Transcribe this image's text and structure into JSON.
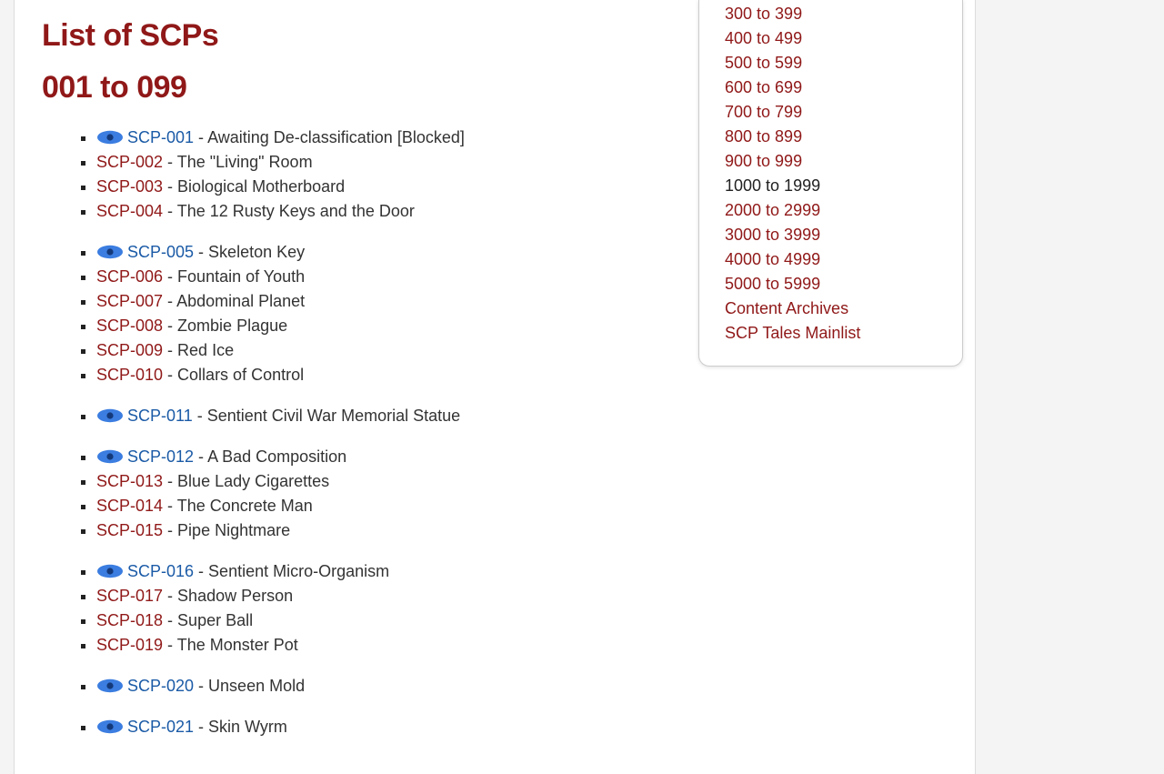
{
  "page": {
    "title": "List of SCPs",
    "section_title": "001 to 099"
  },
  "scp_groups": [
    [
      {
        "id": "SCP-001",
        "title": "Awaiting De-classification [Blocked]",
        "eye": true
      },
      {
        "id": "SCP-002",
        "title": "The \"Living\" Room",
        "eye": false
      },
      {
        "id": "SCP-003",
        "title": "Biological Motherboard",
        "eye": false
      },
      {
        "id": "SCP-004",
        "title": "The 12 Rusty Keys and the Door",
        "eye": false
      }
    ],
    [
      {
        "id": "SCP-005",
        "title": "Skeleton Key",
        "eye": true
      },
      {
        "id": "SCP-006",
        "title": "Fountain of Youth",
        "eye": false
      },
      {
        "id": "SCP-007",
        "title": "Abdominal Planet",
        "eye": false
      },
      {
        "id": "SCP-008",
        "title": "Zombie Plague",
        "eye": false
      },
      {
        "id": "SCP-009",
        "title": "Red Ice",
        "eye": false
      },
      {
        "id": "SCP-010",
        "title": "Collars of Control",
        "eye": false
      }
    ],
    [
      {
        "id": "SCP-011",
        "title": "Sentient Civil War Memorial Statue",
        "eye": true
      }
    ],
    [
      {
        "id": "SCP-012",
        "title": "A Bad Composition",
        "eye": true
      },
      {
        "id": "SCP-013",
        "title": "Blue Lady Cigarettes",
        "eye": false
      },
      {
        "id": "SCP-014",
        "title": "The Concrete Man",
        "eye": false
      },
      {
        "id": "SCP-015",
        "title": "Pipe Nightmare",
        "eye": false
      }
    ],
    [
      {
        "id": "SCP-016",
        "title": "Sentient Micro-Organism",
        "eye": true
      },
      {
        "id": "SCP-017",
        "title": "Shadow Person",
        "eye": false
      },
      {
        "id": "SCP-018",
        "title": "Super Ball",
        "eye": false
      },
      {
        "id": "SCP-019",
        "title": "The Monster Pot",
        "eye": false
      }
    ],
    [
      {
        "id": "SCP-020",
        "title": "Unseen Mold",
        "eye": true
      }
    ],
    [
      {
        "id": "SCP-021",
        "title": "Skin Wyrm",
        "eye": true
      }
    ]
  ],
  "sidebar": {
    "items": [
      {
        "label": "300 to 399",
        "link_style": "red"
      },
      {
        "label": "400 to 499",
        "link_style": "red"
      },
      {
        "label": "500 to 599",
        "link_style": "red"
      },
      {
        "label": "600 to 699",
        "link_style": "red"
      },
      {
        "label": "700 to 799",
        "link_style": "red"
      },
      {
        "label": "800 to 899",
        "link_style": "red"
      },
      {
        "label": "900 to 999",
        "link_style": "red"
      },
      {
        "label": "1000 to 1999",
        "link_style": "plain"
      },
      {
        "label": "2000 to 2999",
        "link_style": "red"
      },
      {
        "label": "3000 to 3999",
        "link_style": "red"
      },
      {
        "label": "4000 to 4999",
        "link_style": "red"
      },
      {
        "label": "5000 to 5999",
        "link_style": "red"
      },
      {
        "label": "Content Archives",
        "link_style": "red"
      },
      {
        "label": "SCP Tales Mainlist",
        "link_style": "red"
      }
    ]
  },
  "separator": " - "
}
